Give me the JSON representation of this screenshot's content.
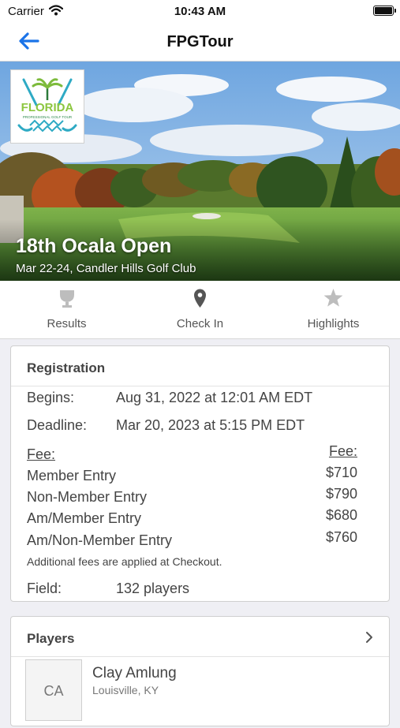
{
  "status_bar": {
    "carrier": "Carrier",
    "time": "10:43 AM"
  },
  "nav": {
    "title": "FPGTour"
  },
  "event": {
    "title": "18th Ocala Open",
    "subtitle": "Mar 22-24, Candler Hills Golf Club",
    "logo": {
      "line1": "FLORIDA",
      "line2": "PROFESSIONAL GOLF TOUR"
    }
  },
  "tabs": [
    {
      "label": "Results",
      "icon": "trophy-icon"
    },
    {
      "label": "Check In",
      "icon": "location-pin-icon"
    },
    {
      "label": "Highlights",
      "icon": "star-icon"
    }
  ],
  "registration": {
    "heading": "Registration",
    "begins_label": "Begins:",
    "begins_value": "Aug 31, 2022 at 12:01 AM EDT",
    "deadline_label": "Deadline:",
    "deadline_value": "Mar 20, 2023 at 5:15 PM EDT",
    "fee_header": "Fee:",
    "fee_header_right": "Fee:",
    "fees": [
      {
        "name": "Member Entry",
        "amount": "$710"
      },
      {
        "name": "Non-Member Entry",
        "amount": "$790"
      },
      {
        "name": "Am/Member Entry",
        "amount": "$680"
      },
      {
        "name": "Am/Non-Member Entry",
        "amount": "$760"
      }
    ],
    "note": "Additional fees are applied at Checkout.",
    "field_label": "Field:",
    "field_value": "132 players"
  },
  "players": {
    "heading": "Players",
    "list": [
      {
        "initials": "CA",
        "name": "Clay Amlung",
        "location": "Louisville, KY"
      }
    ]
  }
}
